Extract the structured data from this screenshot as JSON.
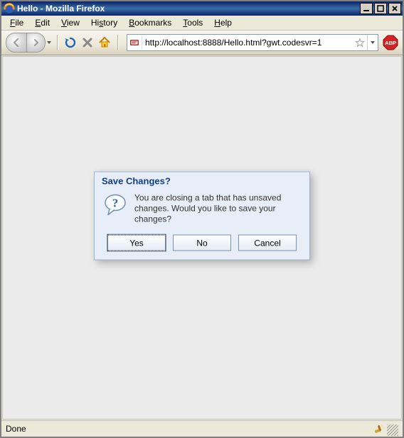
{
  "window": {
    "title": "Hello - Mozilla Firefox"
  },
  "menu": {
    "file": "File",
    "edit": "Edit",
    "view": "View",
    "history": "History",
    "bookmarks": "Bookmarks",
    "tools": "Tools",
    "help": "Help"
  },
  "toolbar": {
    "url": "http://localhost:8888/Hello.html?gwt.codesvr=1"
  },
  "dialog": {
    "title": "Save Changes?",
    "message": "You are closing a tab that has unsaved changes. Would you like to save your changes?",
    "yes": "Yes",
    "no": "No",
    "cancel": "Cancel"
  },
  "statusbar": {
    "text": "Done"
  },
  "colors": {
    "title_gradient_from": "#0a246a",
    "title_gradient_to": "#3a6ea5",
    "chrome_bg": "#ece9d8",
    "content_bg": "#ebebeb",
    "dialog_bg": "#e7eef7",
    "dialog_border": "#99b4d1",
    "dialog_title": "#0f3e8c",
    "url_border": "#7f9db9",
    "abp_red": "#d32323"
  }
}
